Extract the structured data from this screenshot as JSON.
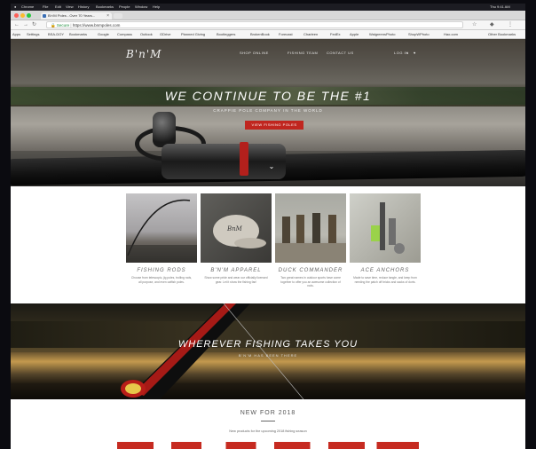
{
  "system": {
    "menu_items": [
      "Chrome",
      "File",
      "Edit",
      "View",
      "History",
      "Bookmarks",
      "People",
      "Window",
      "Help"
    ],
    "time": "Thu 9:41 AM"
  },
  "browser": {
    "tab_title": "B'n'M Poles - Over 70 Years...",
    "url_secure": "Secure",
    "url": "https://www.bnmpoles.com",
    "bookmarks": [
      "Apps",
      "Settings",
      "BSA-DOY",
      "Bookmarks",
      "Google",
      "Compass",
      "Outlook",
      "GDrive",
      "Planned Giving",
      "Bootleggers",
      "BrokenBook",
      "Forecast",
      "Charleen",
      "FedEx",
      "Apple",
      "WalgreensPhoto",
      "ShopWPhoto",
      "Hao.com",
      "Other Bookmarks"
    ]
  },
  "site": {
    "logo": "B'n'M",
    "nav": [
      "SHOP ONLINE",
      "FISHING TEAM",
      "CONTACT US"
    ],
    "nav_right": [
      "LOG IN",
      "⌕",
      "♥"
    ],
    "hero": {
      "title": "WE CONTINUE TO BE THE #1",
      "subtitle": "CRAPPIE POLE COMPANY IN THE WORLD",
      "button": "VIEW FISHING POLES"
    },
    "products": [
      {
        "title": "FISHING RODS",
        "desc": "Choose from telescopic, jig poles, trolling rods, all purpose, and even catfish poles."
      },
      {
        "title": "B'N'M APPAREL",
        "desc": "Show some pride and wear our officially licensed gear. Let it show the fishing fan!"
      },
      {
        "title": "DUCK COMMANDER",
        "desc": "Two great names in outdoor sports have come together to offer you an awesome collection of rods."
      },
      {
        "title": "ACE ANCHORS",
        "desc": "Made to save time, reduce tangle, and keep from needing the patch off bricks and sacks of dorts."
      }
    ],
    "banner2": {
      "title": "WHEREVER FISHING TAKES YOU",
      "subtitle": "B'N'M HAS BEEN THERE"
    },
    "new_section": {
      "title": "NEW FOR 2018",
      "subtitle": "New products for the upcoming 2018 fishing season"
    }
  }
}
